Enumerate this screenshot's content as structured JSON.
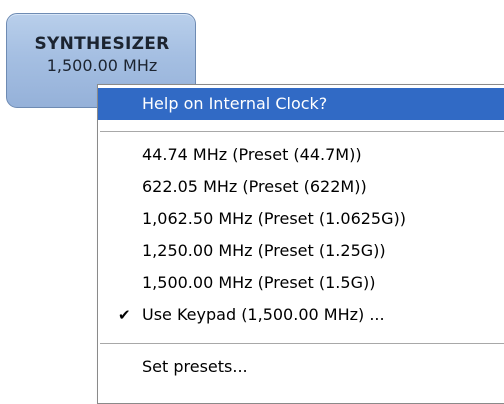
{
  "synthesizer": {
    "title": "SYNTHESIZER",
    "value": "1,500.00 MHz",
    "color_top": "#b9cfeb",
    "color_bottom": "#95b1d9"
  },
  "menu": {
    "highlight_color": "#316ac5",
    "help_item": "Help on Internal Clock?",
    "presets": [
      "44.74 MHz (Preset (44.7M))",
      "622.05 MHz (Preset (622M))",
      "1,062.50 MHz (Preset (1.0625G))",
      "1,250.00 MHz (Preset (1.25G))",
      "1,500.00 MHz (Preset (1.5G))"
    ],
    "keypad_item": "Use Keypad (1,500.00 MHz) ...",
    "keypad_checked": true,
    "check_icon": "✔",
    "set_presets_item": "Set presets..."
  }
}
